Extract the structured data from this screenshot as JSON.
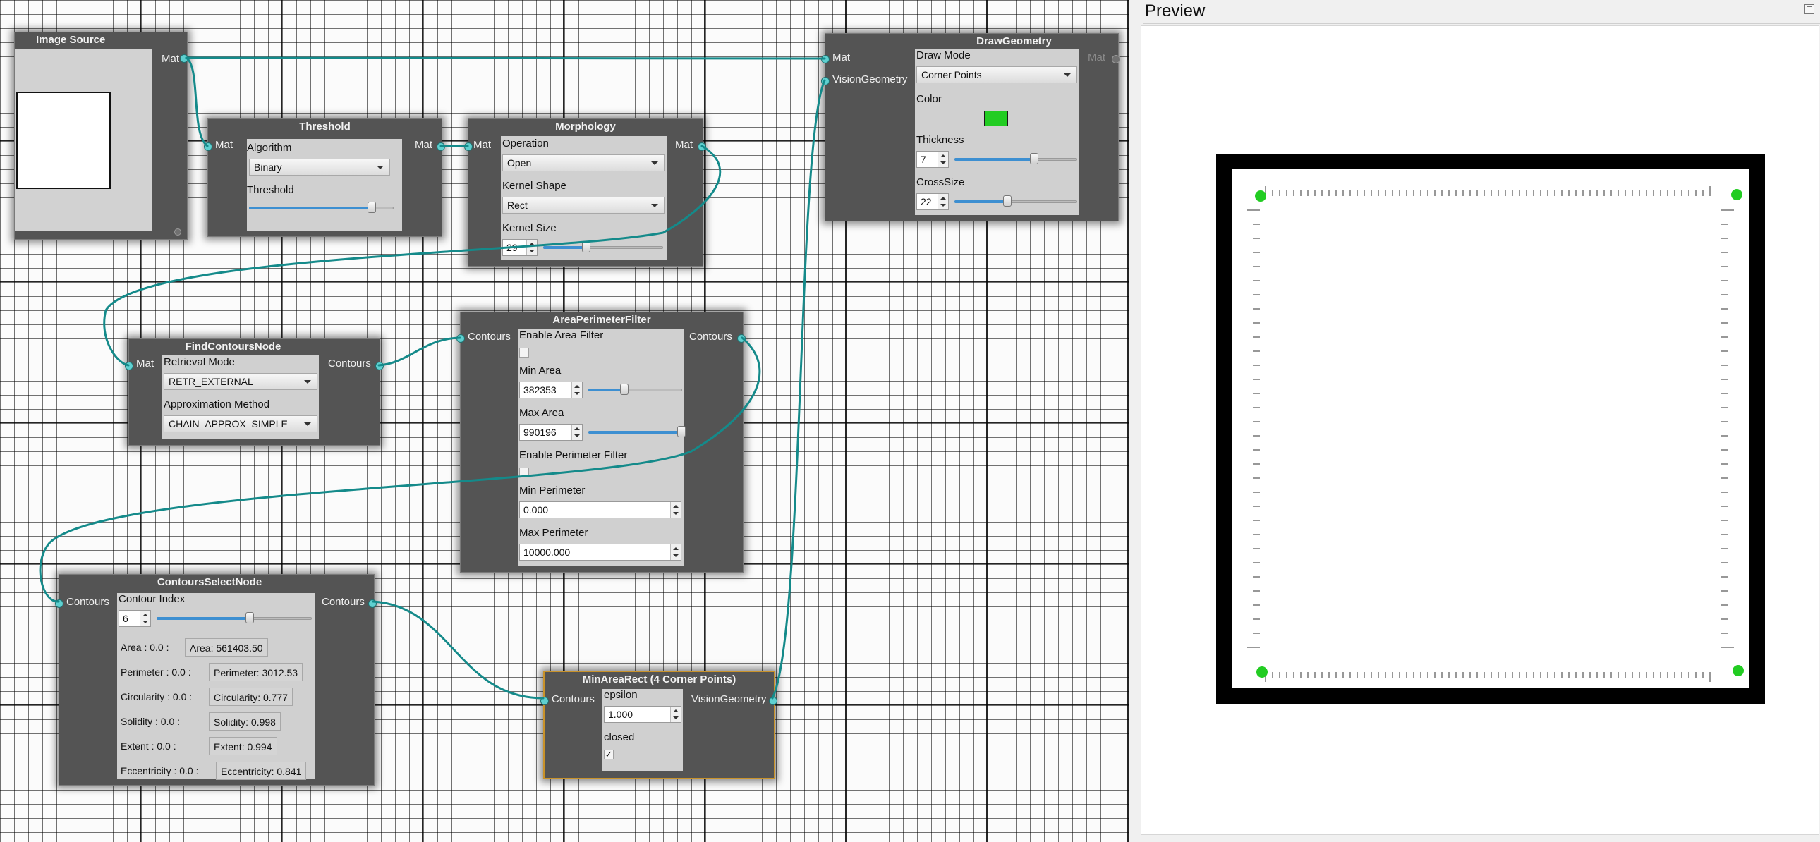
{
  "nodes": {
    "image_source": {
      "title": "Image Source",
      "out": "Mat"
    },
    "threshold": {
      "title": "Threshold",
      "in": "Mat",
      "out": "Mat",
      "algorithm_label": "Algorithm",
      "algorithm_value": "Binary",
      "threshold_label": "Threshold",
      "threshold_level": 0.85
    },
    "morphology": {
      "title": "Morphology",
      "in": "Mat",
      "out": "Mat",
      "operation_label": "Operation",
      "operation_value": "Open",
      "kernel_shape_label": "Kernel Shape",
      "kernel_shape_value": "Rect",
      "kernel_size_label": "Kernel Size",
      "kernel_size_value": "29",
      "kernel_size_level": 0.36
    },
    "draw_geometry": {
      "title": "DrawGeometry",
      "in_mat": "Mat",
      "in_geometry": "VisionGeometry",
      "out": "Mat",
      "draw_mode_label": "Draw Mode",
      "draw_mode_value": "Corner Points",
      "color_label": "Color",
      "color_value": "#22cc22",
      "thickness_label": "Thickness",
      "thickness_value": "7",
      "thickness_level": 0.65,
      "crosssize_label": "CrossSize",
      "crosssize_value": "22",
      "crosssize_level": 0.43
    },
    "find_contours": {
      "title": "FindContoursNode",
      "in": "Mat",
      "out": "Contours",
      "retrieval_label": "Retrieval Mode",
      "retrieval_value": "RETR_EXTERNAL",
      "approx_label": "Approximation Method",
      "approx_value": "CHAIN_APPROX_SIMPLE"
    },
    "area_perimeter": {
      "title": "AreaPerimeterFilter",
      "in": "Contours",
      "out": "Contours",
      "enable_area_label": "Enable Area Filter",
      "min_area_label": "Min Area",
      "min_area_value": "382353",
      "min_area_level": 0.38,
      "max_area_label": "Max Area",
      "max_area_value": "990196",
      "max_area_level": 0.99,
      "enable_perimeter_label": "Enable Perimeter Filter",
      "min_perimeter_label": "Min Perimeter",
      "min_perimeter_value": "0.000",
      "max_perimeter_label": "Max Perimeter",
      "max_perimeter_value": "10000.000"
    },
    "contours_select": {
      "title": "ContoursSelectNode",
      "in": "Contours",
      "out": "Contours",
      "index_label": "Contour Index",
      "index_value": "6",
      "index_level": 0.6,
      "metrics": [
        {
          "left": "Area : 0.0 :",
          "right": "Area: 561403.50"
        },
        {
          "left": "Perimeter : 0.0 :",
          "right": "Perimeter: 3012.53"
        },
        {
          "left": "Circularity : 0.0 :",
          "right": "Circularity: 0.777"
        },
        {
          "left": "Solidity : 0.0 :",
          "right": "Solidity: 0.998"
        },
        {
          "left": "Extent : 0.0 :",
          "right": "Extent: 0.994"
        },
        {
          "left": "Eccentricity : 0.0 :",
          "right": "Eccentricity: 0.841"
        }
      ]
    },
    "min_area_rect": {
      "title": "MinAreaRect (4 Corner Points)",
      "in": "Contours",
      "out": "VisionGeometry",
      "epsilon_label": "epsilon",
      "epsilon_value": "1.000",
      "closed_label": "closed",
      "closed_mark": "✓"
    }
  },
  "preview": {
    "title": "Preview",
    "corner_color": "#22cc22"
  }
}
